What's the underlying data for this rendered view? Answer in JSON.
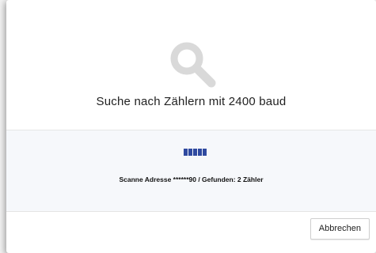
{
  "dialog": {
    "title": "Suche nach Zählern mit 2400 baud",
    "icon": "search-icon",
    "progress_segments": 5,
    "status_text": "Scanne Adresse ******90 / Gefunden: 2 Zähler",
    "cancel_label": "Abbrechen"
  },
  "colors": {
    "icon": "#d9d9d9",
    "progress": "#2f4aa0",
    "body_background": "#f6f8fb"
  }
}
